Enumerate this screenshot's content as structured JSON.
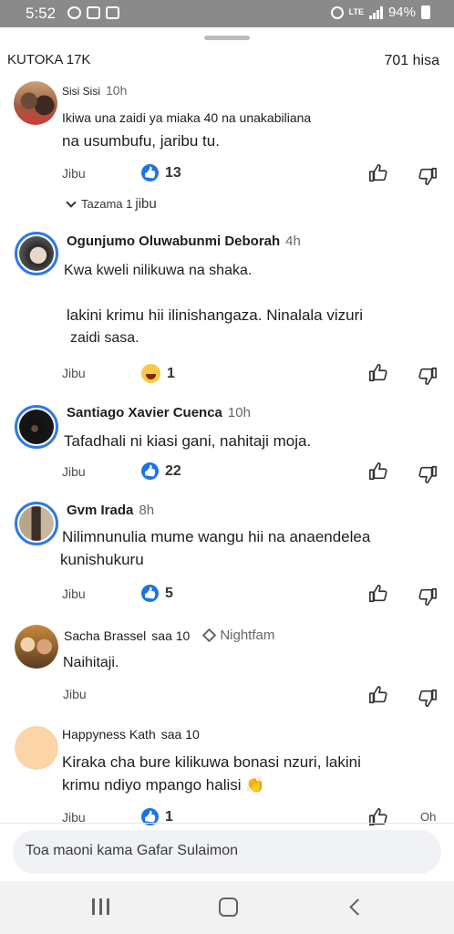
{
  "status_bar": {
    "time": "5:52",
    "network": "LTE",
    "battery": "94%"
  },
  "header": {
    "left": "KUTOKA 17K",
    "right": "701 hisa"
  },
  "view_replies": {
    "prefix": "Tazama 1",
    "suffix": "jibu"
  },
  "comments": [
    {
      "name": "Sisi Sisi",
      "time": "10h",
      "lines": [
        "Ikiwa una zaidi ya miaka 40 na unakabiliana",
        "na usumbufu, jaribu tu."
      ],
      "reply": "Jibu",
      "reaction": "like",
      "count": "13"
    },
    {
      "name": "Ogunjumo Oluwabunmi Deborah",
      "time": "4h",
      "lines": [
        "Kwa kweli nilikuwa na shaka.",
        "lakini krimu hii ilinishangaza. Ninalala vizuri",
        "zaidi sasa."
      ],
      "reply": "Jibu",
      "reaction": "haha",
      "count": "1"
    },
    {
      "name": "Santiago Xavier Cuenca",
      "time": "10h",
      "lines": [
        "Tafadhali ni kiasi gani, nahitaji moja."
      ],
      "reply": "Jibu",
      "reaction": "like",
      "count": "22"
    },
    {
      "name": "Gvm Irada",
      "time": "8h",
      "lines": [
        "Nilimnunulia mume wangu hii na anaendelea",
        "kunishukuru"
      ],
      "reply": "Jibu",
      "reaction": "like",
      "count": "5"
    },
    {
      "name": "Sacha Brassel",
      "time": "saa 10",
      "badge": "Nightfam",
      "lines": [
        "Naihitaji."
      ],
      "reply": "Jibu"
    },
    {
      "name": "Happyness Kath",
      "time": "saa 10",
      "lines": [
        "Kiraka cha bure kilikuwa bonasi nzuri, lakini",
        "krimu ndiyo mpango halisi 👏"
      ],
      "reply": "Jibu",
      "reaction": "like",
      "count": "1",
      "extra": "Oh"
    }
  ],
  "input": {
    "placeholder": "Toa maoni kama Gafar Sulaimon"
  },
  "colors": {
    "accent": "#1b74e4",
    "ring": "#2d79e7",
    "muted": "#65676b"
  },
  "icons": [
    "like-icon",
    "dislike-icon",
    "haha-icon",
    "clap-emoji"
  ]
}
